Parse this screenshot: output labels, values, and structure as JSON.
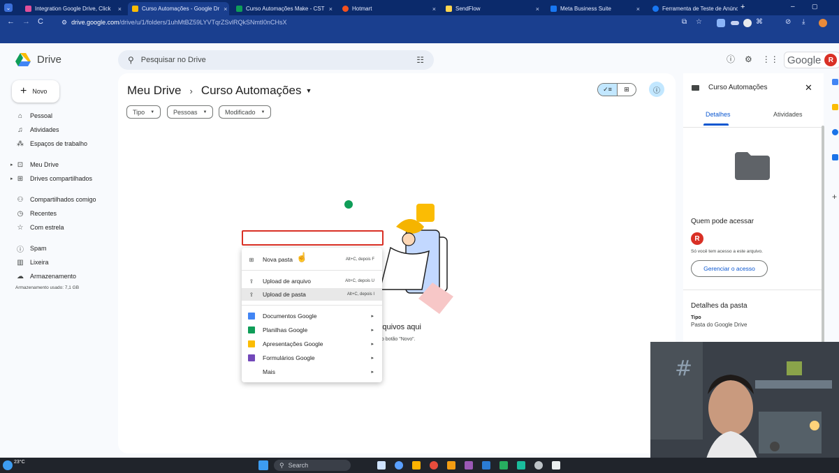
{
  "browser": {
    "tabs": [
      {
        "title": "Integration Google Drive, Click",
        "color": "#e04f9a"
      },
      {
        "title": "Curso Automações - Google Dr",
        "color": "#fbbc04"
      },
      {
        "title": "Curso Automações Make - CST",
        "color": "#0f9d58"
      },
      {
        "title": "Hotmart",
        "color": "#f4511e"
      },
      {
        "title": "SendFlow",
        "color": "#ffd54f"
      },
      {
        "title": "Meta Business Suite",
        "color": "#1877f2"
      },
      {
        "title": "Ferramenta de Teste de Anúnc",
        "color": "#1877f2"
      }
    ],
    "tab_close": "×",
    "new_tab": "+",
    "minimize": "–",
    "restore": "▢",
    "url_host": "drive.google.com",
    "url_path": "/drive/u/1/folders/1uhMtBZ59LYVTqrZSvlRQkSNmtI0nCHsX",
    "back": "←",
    "forward": "→",
    "reload": "C"
  },
  "drive": {
    "app_name": "Drive",
    "search_placeholder": "Pesquisar no Drive",
    "google_label": "Google",
    "avatar_letter": "R",
    "new_button": "Novo",
    "nav": [
      {
        "label": "Pessoal",
        "icon": "home-icon"
      },
      {
        "label": "Atividades",
        "icon": "bell-icon"
      },
      {
        "label": "Espaços de trabalho",
        "icon": "workspaces-icon"
      },
      {
        "label": "Meu Drive",
        "icon": "my-drive-icon"
      },
      {
        "label": "Drives compartilhados",
        "icon": "shared-drives-icon"
      },
      {
        "label": "Compartilhados comigo",
        "icon": "people-icon"
      },
      {
        "label": "Recentes",
        "icon": "clock-icon"
      },
      {
        "label": "Com estrela",
        "icon": "star-icon"
      },
      {
        "label": "Spam",
        "icon": "spam-icon"
      },
      {
        "label": "Lixeira",
        "icon": "trash-icon"
      },
      {
        "label": "Armazenamento",
        "icon": "cloud-icon"
      }
    ],
    "storage_used": "Armazenamento usado: 7,1 GB",
    "breadcrumb": {
      "root": "Meu Drive",
      "current": "Curso Automações"
    },
    "filters": [
      "Tipo",
      "Pessoas",
      "Modificado"
    ],
    "empty_title_partial": "s arquivos aqui",
    "empty_subtitle_partial": "ou use o botão \"Novo\"."
  },
  "context_menu": {
    "items": [
      {
        "label": "Nova pasta",
        "shortcut": "Alt+C, depois F"
      },
      {
        "label": "Upload de arquivo",
        "shortcut": "Alt+C, depois U"
      },
      {
        "label": "Upload de pasta",
        "shortcut": "Alt+C, depois I"
      },
      {
        "label": "Documentos Google",
        "color": "#4285f4"
      },
      {
        "label": "Planilhas Google",
        "color": "#0f9d58"
      },
      {
        "label": "Apresentações Google",
        "color": "#fbbc04"
      },
      {
        "label": "Formulários Google",
        "color": "#7248b9"
      },
      {
        "label": "Mais"
      }
    ],
    "highlighted_item": "Upload de arquivo",
    "hovered_item": "Upload de pasta"
  },
  "details_panel": {
    "title": "Curso Automações",
    "tabs": [
      "Detalhes",
      "Atividades"
    ],
    "active_tab": "Detalhes",
    "access_heading": "Quem pode acessar",
    "access_avatar": "R",
    "access_text": "Só você tem acesso a este arquivo.",
    "manage_button": "Gerenciar o acesso",
    "folder_details_heading": "Detalhes da pasta",
    "type_label": "Tipo",
    "type_value": "Pasta do Google Drive"
  },
  "taskbar": {
    "temperature": "23°C",
    "search_placeholder": "Search"
  },
  "colors": {
    "accent": "#0b57d0",
    "highlight_border": "#d93025",
    "selected_chip": "#c2e7ff",
    "chrome_bg": "#1a3f8f"
  }
}
